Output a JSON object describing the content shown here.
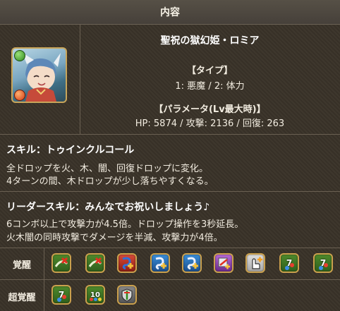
{
  "header": {
    "title": "内容"
  },
  "monster": {
    "name": "聖祝の獄幻姫・ロミア",
    "type_heading": "【タイプ】",
    "type_value": "1: 悪魔 / 2: 体力",
    "param_heading": "【パラメータ(Lv最大時)】",
    "param_value": "HP: 5874 / 攻撃: 2136 / 回復: 263",
    "portrait_icon": "character-portrait",
    "main_attribute": "wood",
    "sub_attribute": "fire"
  },
  "skill": {
    "title": "スキル：トゥインクルコール",
    "line1": "全ドロップを火、木、闇、回復ドロップに変化。",
    "line2": "4ターンの間、木ドロップが少し落ちやすくなる。"
  },
  "leader_skill": {
    "title": "リーダースキル：みんなでお祝いしましょう♪",
    "line1": "6コンボ以上で攻撃力が4.5倍。ドロップ操作を3秒延長。",
    "line2": "火木闇の同時攻撃でダメージを半減、攻撃力が4倍。"
  },
  "awakenings": {
    "label": "覚醒",
    "items": [
      {
        "name": "bind-resist-icon"
      },
      {
        "name": "bind-resist-icon"
      },
      {
        "name": "skill-boost-plus-icon"
      },
      {
        "name": "skill-boost-plus-icon"
      },
      {
        "name": "skill-boost-plus-icon"
      },
      {
        "name": "jammer-resist-plus-icon"
      },
      {
        "name": "extend-time-plus-icon"
      },
      {
        "name": "seven-combo-icon"
      },
      {
        "name": "seven-combo-icon"
      }
    ]
  },
  "super_awakenings": {
    "label": "超覚醒",
    "items": [
      {
        "name": "seven-combo-icon"
      },
      {
        "name": "ten-combo-icon"
      },
      {
        "name": "guard-break-icon"
      }
    ]
  }
}
